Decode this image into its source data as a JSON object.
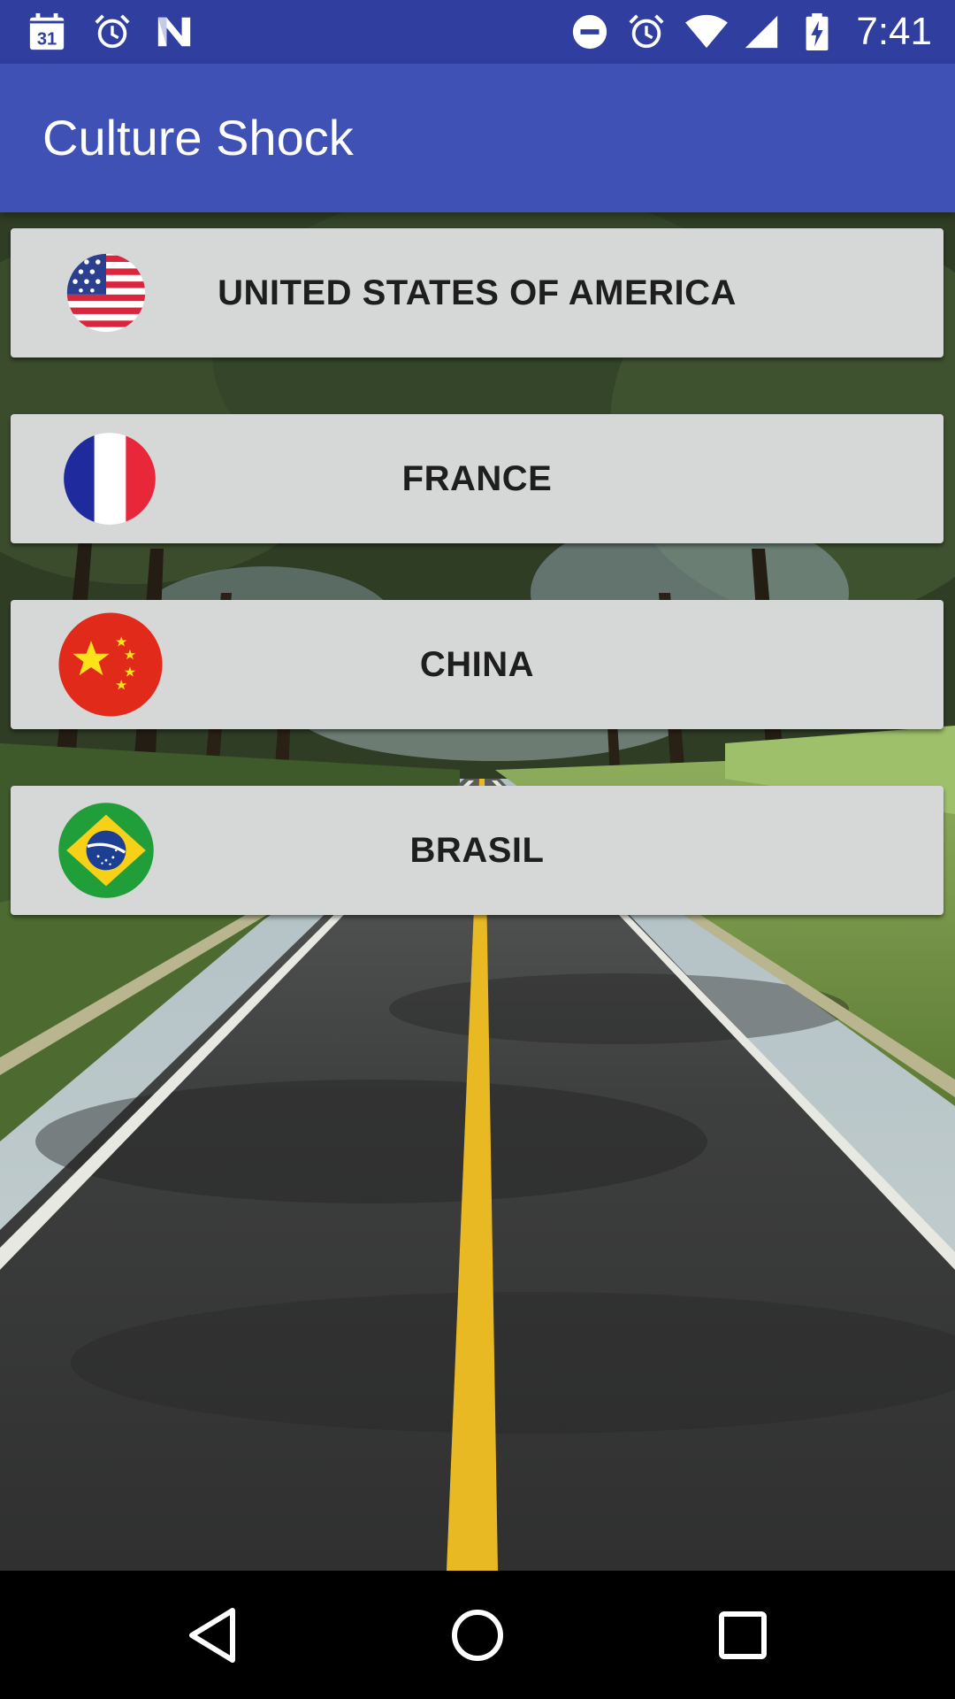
{
  "status_bar": {
    "time": "7:41",
    "calendar_date": "31",
    "left_icons": [
      "calendar-icon",
      "alarm-icon",
      "n-logo-icon"
    ],
    "right_icons": [
      "do-not-disturb-icon",
      "alarm-icon",
      "wifi-icon",
      "signal-icon",
      "battery-charging-icon"
    ]
  },
  "app_bar": {
    "title": "Culture Shock"
  },
  "countries": [
    {
      "label": "UNITED STATES OF AMERICA",
      "flag": "usa-flag-icon"
    },
    {
      "label": "FRANCE",
      "flag": "france-flag-icon"
    },
    {
      "label": "CHINA",
      "flag": "china-flag-icon"
    },
    {
      "label": "BRASIL",
      "flag": "brazil-flag-icon"
    }
  ],
  "nav_bar": {
    "buttons": [
      "back-icon",
      "home-icon",
      "recents-icon"
    ]
  },
  "colors": {
    "status_bar": "#303f9f",
    "app_bar": "#3f51b5",
    "button_bg": "#d6d7d7",
    "road_line": "#e8b923"
  }
}
